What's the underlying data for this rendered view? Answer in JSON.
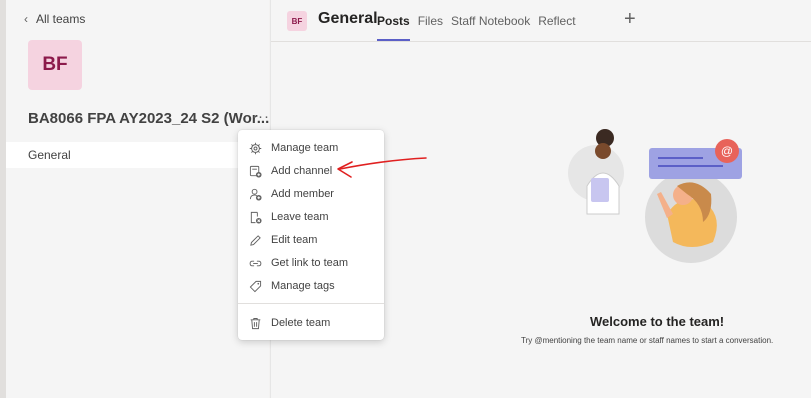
{
  "sidebar": {
    "back_label": "All teams",
    "team_initials": "BF",
    "team_name": "BA8066 FPA AY2023_24 S2 (Wor...",
    "more_label": "···",
    "channels": [
      {
        "label": "General",
        "selected": true
      }
    ]
  },
  "header": {
    "channel_initials": "BF",
    "channel_title": "General",
    "tabs": [
      {
        "label": "Posts",
        "active": true
      },
      {
        "label": "Files",
        "active": false
      },
      {
        "label": "Staff Notebook",
        "active": false
      },
      {
        "label": "Reflect",
        "active": false
      }
    ],
    "add_tab_label": "+"
  },
  "context_menu": {
    "items": [
      {
        "label": "Manage team",
        "icon": "gear-icon"
      },
      {
        "label": "Add channel",
        "icon": "add-channel-icon"
      },
      {
        "label": "Add member",
        "icon": "add-member-icon"
      },
      {
        "label": "Leave team",
        "icon": "leave-team-icon"
      },
      {
        "label": "Edit team",
        "icon": "pencil-icon"
      },
      {
        "label": "Get link to team",
        "icon": "link-icon"
      },
      {
        "label": "Manage tags",
        "icon": "tag-icon"
      },
      {
        "label": "Delete team",
        "icon": "trash-icon"
      }
    ]
  },
  "welcome": {
    "title": "Welcome to the team!",
    "subtitle": "Try @mentioning the team name or staff names to start a conversation."
  },
  "colors": {
    "accent": "#5b5fc7",
    "team_avatar_bg": "#f5d3e0",
    "team_avatar_fg": "#8c1a4b",
    "annotation_arrow": "#e02020"
  }
}
